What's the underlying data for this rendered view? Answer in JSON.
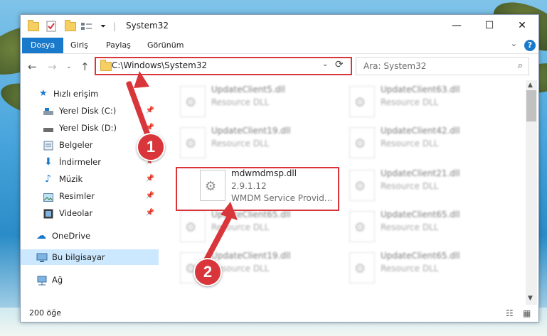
{
  "window": {
    "title": "System32",
    "controls": {
      "minimize": "—",
      "maximize": "☐",
      "close": "✕"
    }
  },
  "ribbon": {
    "tabs": [
      "Dosya",
      "Giriş",
      "Paylaş",
      "Görünüm"
    ],
    "active_tab": "Dosya",
    "help": "?",
    "collapse": "⌄"
  },
  "navigation": {
    "address": "C:\\Windows\\System32",
    "search_placeholder": "Ara: System32"
  },
  "sidebar": {
    "items": [
      {
        "label": "Hızlı erişim",
        "icon": "star-icon",
        "pinned": false
      },
      {
        "label": "Yerel Disk (C:)",
        "icon": "drive-icon",
        "pinned": true
      },
      {
        "label": "Yerel Disk (D:)",
        "icon": "drive-icon",
        "pinned": true
      },
      {
        "label": "Belgeler",
        "icon": "documents-icon",
        "pinned": true
      },
      {
        "label": "İndirmeler",
        "icon": "download-icon",
        "pinned": true
      },
      {
        "label": "Müzik",
        "icon": "music-icon",
        "pinned": true
      },
      {
        "label": "Resimler",
        "icon": "pictures-icon",
        "pinned": true
      },
      {
        "label": "Videolar",
        "icon": "video-icon",
        "pinned": true
      },
      {
        "label": "OneDrive",
        "icon": "cloud-icon",
        "pinned": false
      },
      {
        "label": "Bu bilgisayar",
        "icon": "computer-icon",
        "pinned": false,
        "selected": true
      },
      {
        "label": "Ağ",
        "icon": "network-icon",
        "pinned": false
      }
    ]
  },
  "files": [
    {
      "name": "UpdateClient5.dll",
      "desc": "Resource DLL",
      "blurred": true
    },
    {
      "name": "UpdateClient63.dll",
      "desc": "Resource DLL",
      "blurred": true
    },
    {
      "name": "UpdateClient19.dll",
      "desc": "Resource DLL",
      "blurred": true
    },
    {
      "name": "UpdateClient42.dll",
      "desc": "Resource DLL",
      "blurred": true
    },
    {
      "name": "mdwmdmsp.dll",
      "version": "2.9.1.12",
      "desc": "WMDM Service Provid...",
      "blurred": false
    },
    {
      "name": "UpdateClient21.dll",
      "desc": "Resource DLL",
      "blurred": true
    },
    {
      "name": "UpdateClient65.dll",
      "desc": "Resource DLL",
      "blurred": true
    },
    {
      "name": "UpdateClient65.dll",
      "desc": "Resource DLL",
      "blurred": true
    },
    {
      "name": "UpdateClient19.dll",
      "desc": "Resource DLL",
      "blurred": true
    },
    {
      "name": "UpdateClient65.dll",
      "desc": "Resource DLL",
      "blurred": true
    }
  ],
  "status": {
    "item_count": "200 öğe"
  },
  "callouts": [
    {
      "label": "1"
    },
    {
      "label": "2"
    }
  ],
  "colors": {
    "accent": "#1979ca",
    "highlight": "#d9363b",
    "selected_bg": "#cce8ff"
  }
}
